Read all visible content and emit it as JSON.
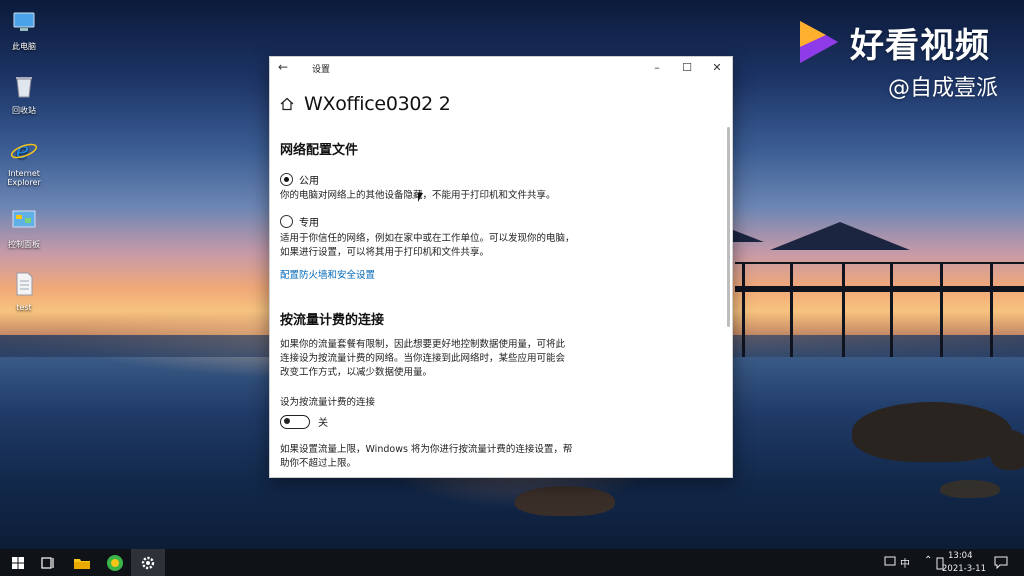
{
  "watermark": {
    "brand": "好看视频",
    "author": "@自成壹派"
  },
  "desktop": {
    "icons": [
      {
        "label": "此电脑",
        "icon": "computer-icon"
      },
      {
        "label": "回收站",
        "icon": "recycle-bin-icon"
      },
      {
        "label": "Internet Explorer",
        "icon": "internet-explorer-icon"
      },
      {
        "label": "控制面板",
        "icon": "control-panel-icon"
      },
      {
        "label": "test",
        "icon": "text-file-icon"
      }
    ]
  },
  "window": {
    "title": "设置",
    "page_title": "WXoffice0302 2",
    "network_profile": {
      "heading": "网络配置文件",
      "options": [
        {
          "label": "公用",
          "selected": true,
          "description": "你的电脑对网络上的其他设备隐藏，不能用于打印机和文件共享。"
        },
        {
          "label": "专用",
          "selected": false,
          "description": "适用于你信任的网络，例如在家中或在工作单位。可以发现你的电脑，如果进行设置，可以将其用于打印机和文件共享。"
        }
      ],
      "firewall_link": "配置防火墙和安全设置"
    },
    "metered": {
      "heading": "按流量计费的连接",
      "description": "如果你的流量套餐有限制，因此想要更好地控制数据使用量，可将此连接设为按流量计费的网络。当你连接到此网络时，某些应用可能会改变工作方式，以减少数据使用量。",
      "toggle_label": "设为按流量计费的连接",
      "toggle_state": "关",
      "toggle_on": false,
      "footer": "如果设置流量上限，Windows 将为你进行按流量计费的连接设置，帮助你不超过上限。"
    }
  },
  "taskbar": {
    "ime": "中",
    "time": "13:04",
    "date": "2021-3-11"
  }
}
